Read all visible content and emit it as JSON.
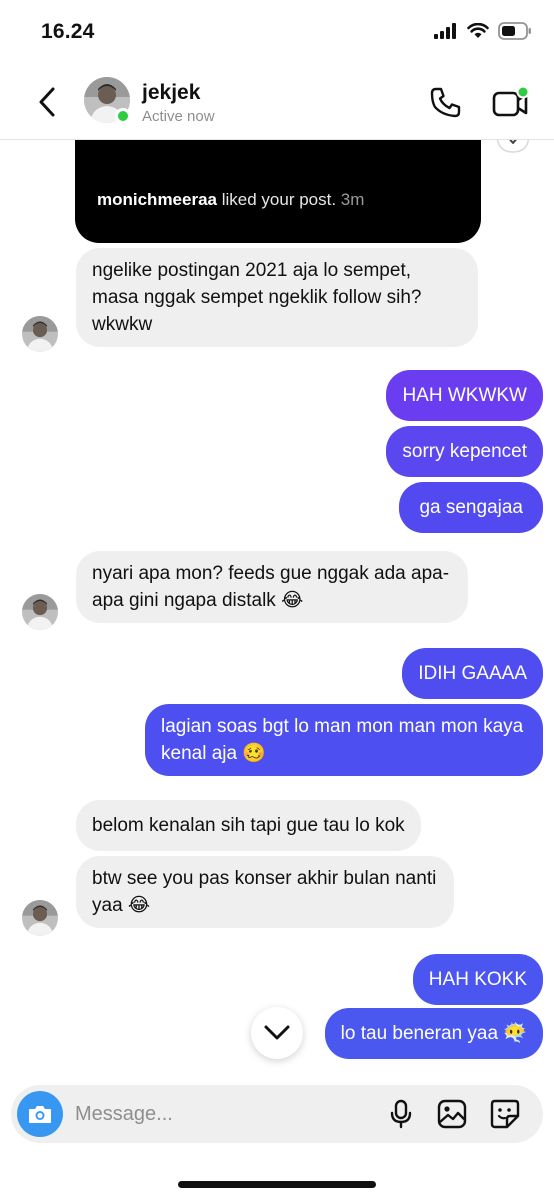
{
  "status_bar": {
    "time": "16.24"
  },
  "header": {
    "contact_name": "jekjek",
    "contact_status": "Active now"
  },
  "shared_post": {
    "username": "monichmeeraa",
    "action": " liked your post. ",
    "time": "3m"
  },
  "messages": [
    {
      "from": "them",
      "text": "ngelike postingan 2021 aja lo sempet, masa nggak sempet ngeklik follow sih? wkwkw"
    },
    {
      "from": "me",
      "text": "HAH WKWKW"
    },
    {
      "from": "me",
      "text": "sorry kepencet"
    },
    {
      "from": "me",
      "text": "ga sengajaa"
    },
    {
      "from": "them",
      "text": "nyari apa mon? feeds gue nggak ada apa-apa gini ngapa distalk 😂"
    },
    {
      "from": "me",
      "text": "IDIH GAAAA"
    },
    {
      "from": "me",
      "text": "lagian soas bgt lo man mon man mon kaya kenal aja 🥴"
    },
    {
      "from": "them",
      "text": "belom kenalan sih tapi gue tau lo kok"
    },
    {
      "from": "them",
      "text": "btw see you pas konser akhir bulan nanti yaa 😂"
    },
    {
      "from": "me",
      "text": "HAH KOKK"
    },
    {
      "from": "me",
      "text": "lo tau beneran yaa 😶‍🌫️"
    }
  ],
  "composer": {
    "placeholder": "Message..."
  },
  "colors": {
    "outgoing_bubble": "#4d4ff0",
    "incoming_bubble": "#efefef",
    "camera_button": "#3897f0",
    "online_dot": "#2ecc40"
  }
}
